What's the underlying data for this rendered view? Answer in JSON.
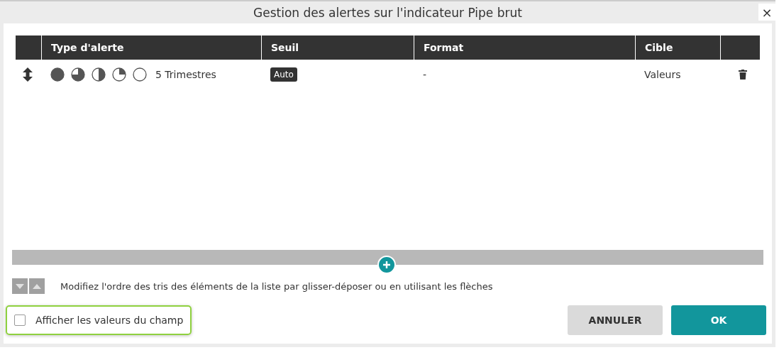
{
  "dialog": {
    "title": "Gestion des alertes sur l'indicateur Pipe brut",
    "close": "×"
  },
  "table": {
    "columns": [
      "Type d'alerte",
      "Seuil",
      "Format",
      "Cible"
    ],
    "rows": [
      {
        "alert_type": "5 Trimestres",
        "threshold": "Auto",
        "format": "-",
        "target": "Valeurs"
      }
    ]
  },
  "hint": "Modifiez l'ordre des tris des éléments de la liste par glisser-déposer ou en utilisant les flèches",
  "checkbox": {
    "label": "Afficher les valeurs du champ",
    "checked": false,
    "highlighted": true
  },
  "buttons": [
    {
      "label": "ANNULER",
      "kind": "secondary"
    },
    {
      "label": "OK",
      "kind": "primary"
    }
  ]
}
